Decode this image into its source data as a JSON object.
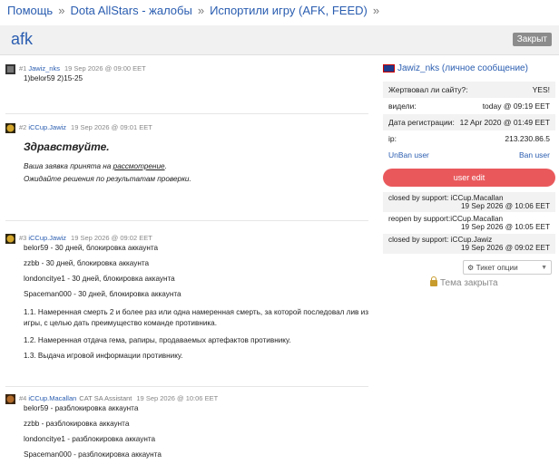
{
  "breadcrumb": [
    "Помощь",
    "Dota AllStars - жалобы",
    "Испортили игру (AFK, FEED)"
  ],
  "title": "afk",
  "closed_badge": "Закрыт",
  "posts": [
    {
      "num": "#1",
      "author": "Jawiz_nks",
      "role": "",
      "date": "19 Sep 2026 @ 09:00 EET",
      "lines": [
        "1)belor59 2)15-25"
      ]
    },
    {
      "num": "#2",
      "author": "iCCup.Jawiz",
      "role": "",
      "date": "19 Sep 2026 @ 09:01 EET",
      "heading": "Здравствуйте.",
      "line1_a": "Ваша заявка принята на ",
      "line1_link": "рассмотрение",
      "line1_b": ".",
      "line2": "Ожидайте решения по результатам проверки."
    },
    {
      "num": "#3",
      "author": "iCCup.Jawiz",
      "role": "",
      "date": "19 Sep 2026 @ 09:02 EET",
      "lines": [
        "belor59 - 30 дней, блокировка аккаунта",
        "zzbb - 30 дней, блокировка аккаунта",
        "londoncitye1 - 30 дней, блокировка аккаунта",
        "Spaceman000 - 30 дней, блокировка аккаунта",
        "1.1. Намеренная смерть 2 и более раз или одна намеренная смерть, за которой последовал лив из игры, с целью дать преимущество команде противника.",
        "1.2. Намеренная отдача гема, рапиры, продаваемых артефактов противнику.",
        "1.3. Выдача игровой информации противнику."
      ]
    },
    {
      "num": "#4",
      "author": "iCCup.Macallan",
      "role": "CAT SA Assistant",
      "date": "19 Sep 2026 @ 10:06 EET",
      "lines": [
        "belor59 - разблокировка аккаунта",
        "zzbb - разблокировка аккаунта",
        "londoncitye1 - разблокировка аккаунта",
        "Spaceman000 - разблокировка аккаунта"
      ]
    }
  ],
  "sidebar": {
    "user": "Jawiz_nks (личное сообщение)",
    "rows": [
      {
        "label": "Жертвовал ли сайту?:",
        "value": "YES!"
      },
      {
        "label": "видели:",
        "value": "today @ 09:19 EET"
      },
      {
        "label": "Дата регистрации:",
        "value": "12 Apr 2020 @ 01:49 EET"
      },
      {
        "label": "ip:",
        "value": "213.230.86.5"
      }
    ],
    "unban": "UnBan user",
    "ban": "Ban user",
    "edit_btn": "user edit",
    "log": [
      {
        "text": "closed by support: iCCup.Macallan",
        "date": "19 Sep 2026 @ 10:06 EET"
      },
      {
        "text": "reopen by support:iCCup.Macallan",
        "date": "19 Sep 2026 @ 10:05 EET"
      },
      {
        "text": "closed by support: iCCup.Jawiz",
        "date": "19 Sep 2026 @ 09:02 EET"
      }
    ],
    "ticket_options": "Тикет опции",
    "closed_note": "Тема закрыта"
  },
  "colors": {
    "accent": "#2a5db0",
    "button": "#e9595c",
    "badge": "#8c8c8c"
  }
}
